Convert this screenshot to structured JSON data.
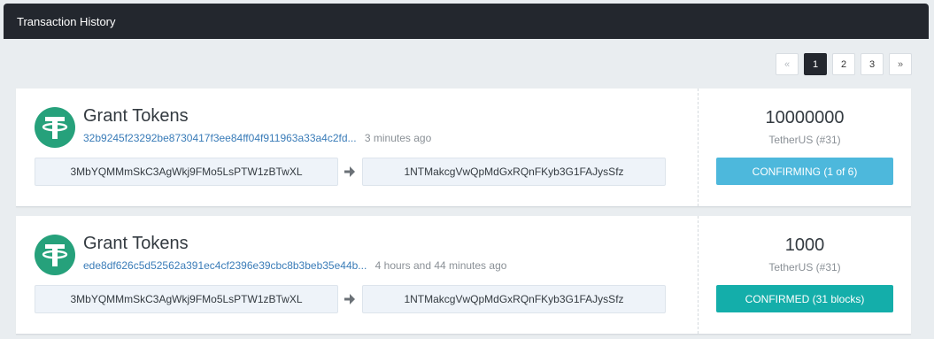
{
  "panel": {
    "title": "Transaction History"
  },
  "pagination": {
    "prev": "«",
    "pages": [
      "1",
      "2",
      "3"
    ],
    "active": "1",
    "next": "»"
  },
  "transactions": [
    {
      "title": "Grant Tokens",
      "hash": "32b9245f23292be8730417f3ee84ff04f911963a33a4c2fd...",
      "time": "3 minutes ago",
      "from": "3MbYQMMmSkC3AgWkj9FMo5LsPTW1zBTwXL",
      "to": "1NTMakcgVwQpMdGxRQnFKyb3G1FAJysSfz",
      "amount": "10000000",
      "currency": "TetherUS (#31)",
      "status": "CONFIRMING (1 of 6)",
      "status_color": "#4db8dc"
    },
    {
      "title": "Grant Tokens",
      "hash": "ede8df626c5d52562a391ec4cf2396e39cbc8b3beb35e44b...",
      "time": "4 hours and 44 minutes ago",
      "from": "3MbYQMMmSkC3AgWkj9FMo5LsPTW1zBTwXL",
      "to": "1NTMakcgVwQpMdGxRQnFKyb3G1FAJysSfz",
      "amount": "1000",
      "currency": "TetherUS (#31)",
      "status": "CONFIRMED (31 blocks)",
      "status_color": "#14aeaa"
    }
  ],
  "icons": {
    "token": "tether-icon",
    "transfer": "arrow-right-icon"
  },
  "colors": {
    "header_bg": "#23272e",
    "tether_green": "#26a17b",
    "link": "#3a7cb8"
  }
}
